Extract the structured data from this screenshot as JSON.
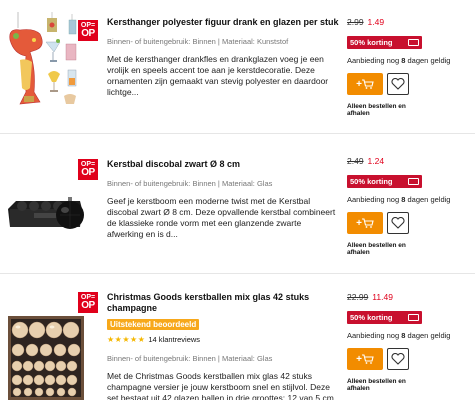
{
  "colors": {
    "brand_red": "#e0001b",
    "discount_bg": "#c8102e",
    "cart_orange": "#f28c00",
    "rating_badge": "#f7a81b",
    "star": "#f5b700"
  },
  "products": [
    {
      "badge_top": "OP=",
      "badge_bottom": "OP",
      "title": "Kersthanger polyester figuur drank en glazen per stuk",
      "meta": "Binnen- of buitengebruik: Binnen | Materiaal: Kunststof",
      "description": "Met de kersthanger drankfles en drankglazen voeg je een vrolijk en speels accent toe aan je kerstdecoratie. Deze ornamenten zijn gemaakt van stevig polyester en daardoor lichtge...",
      "old_price": "2.99",
      "new_price": "1.49",
      "discount": "50% korting",
      "valid_prefix": "Aanbieding nog",
      "valid_days": "8",
      "valid_suffix": "dagen geldig",
      "cart_label": "+",
      "pickup": "Alleen bestellen en afhalen",
      "image_icon": "drink-glass-ornaments"
    },
    {
      "badge_top": "OP=",
      "badge_bottom": "OP",
      "title": "Kerstbal discobal zwart Ø 8 cm",
      "meta": "Binnen- of buitengebruik: Binnen | Materiaal: Glas",
      "description": "Geef je kerstboom een moderne twist met de Kerstbal discobal zwart Ø 8 cm. Deze opvallende kerstbal combineert de klassieke ronde vorm met een glanzende zwarte afwerking en is d...",
      "old_price": "2.49",
      "new_price": "1.24",
      "discount": "50% korting",
      "valid_prefix": "Aanbieding nog",
      "valid_days": "8",
      "valid_suffix": "dagen geldig",
      "cart_label": "+",
      "pickup": "Alleen bestellen en afhalen",
      "image_icon": "black-disco-ball"
    },
    {
      "badge_top": "OP=",
      "badge_bottom": "OP",
      "title": "Christmas Goods kerstballen mix glas 42 stuks champagne",
      "rating_label": "Uitstekend beoordeeld",
      "stars": "★★★★★",
      "reviews": "14 klantreviews",
      "meta": "Binnen- of buitengebruik: Binnen | Materiaal: Glas",
      "description": "Met de Christmas Goods kerstballen mix glas 42 stuks champagne versier je jouw kerstboom snel en stijlvol. Deze set bestaat uit 42 glazen ballen in drie groottes: 12 van 5 cm, 1...",
      "old_price": "22.99",
      "new_price": "11.49",
      "discount": "50% korting",
      "valid_prefix": "Aanbieding nog",
      "valid_days": "8",
      "valid_suffix": "dagen geldig",
      "cart_label": "+",
      "pickup": "Alleen bestellen en afhalen",
      "image_icon": "champagne-baubles-box"
    }
  ]
}
